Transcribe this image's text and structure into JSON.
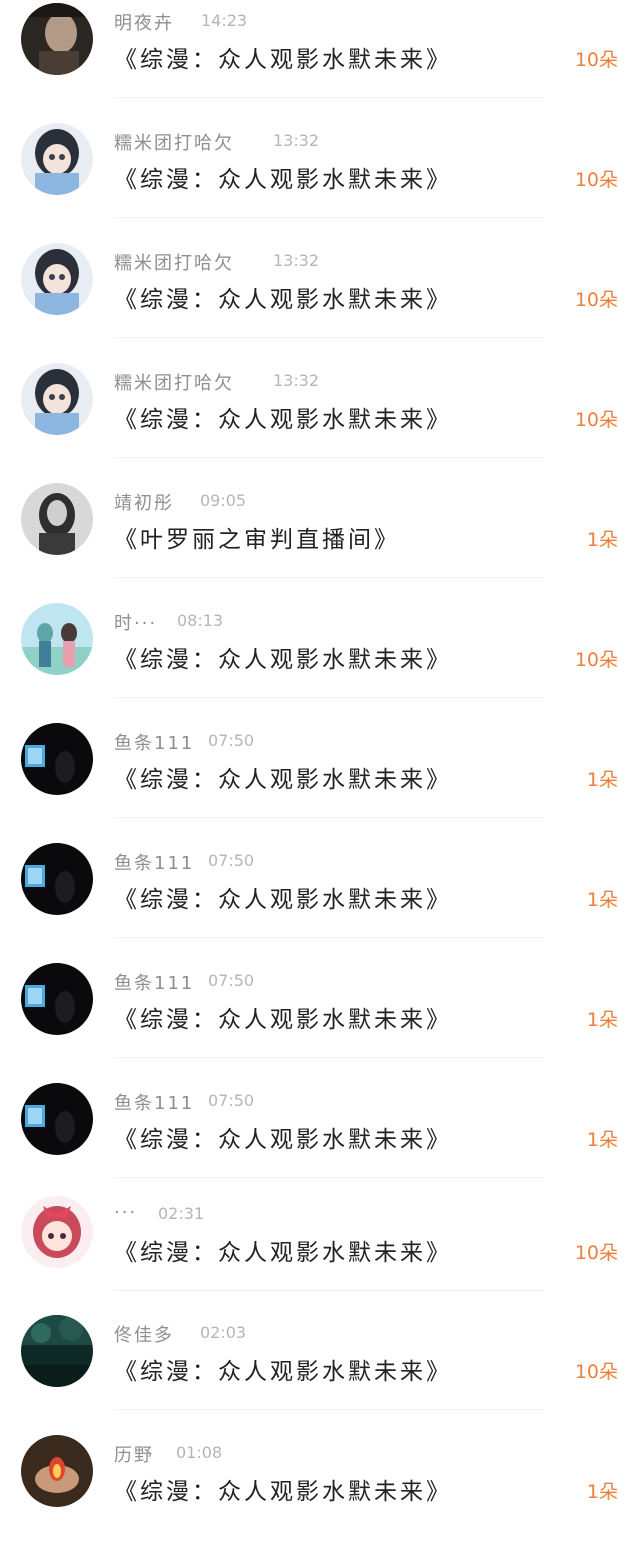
{
  "messages": [
    {
      "name": "明夜卉",
      "time": "14:23",
      "title": "《综漫：众人观影水默未来》",
      "count": "10朵",
      "avatar": "dark-portrait-icon"
    },
    {
      "name": "糯米团打哈欠",
      "time": "13:32",
      "title": "《综漫：众人观影水默未来》",
      "count": "10朵",
      "avatar": "anime-girl-icon"
    },
    {
      "name": "糯米团打哈欠",
      "time": "13:32",
      "title": "《综漫：众人观影水默未来》",
      "count": "10朵",
      "avatar": "anime-girl-icon"
    },
    {
      "name": "糯米团打哈欠",
      "time": "13:32",
      "title": "《综漫：众人观影水默未来》",
      "count": "10朵",
      "avatar": "anime-girl-icon"
    },
    {
      "name": "靖初彤",
      "time": "09:05",
      "title": "《叶罗丽之审判直播间》",
      "count": "1朵",
      "avatar": "grayscale-portrait-icon"
    },
    {
      "name": "时···",
      "time": "08:13",
      "title": "《综漫：众人观影水默未来》",
      "count": "10朵",
      "avatar": "anime-couple-icon"
    },
    {
      "name": "鱼条111",
      "time": "07:50",
      "title": "《综漫：众人观影水默未来》",
      "count": "1朵",
      "avatar": "dark-screen-icon"
    },
    {
      "name": "鱼条111",
      "time": "07:50",
      "title": "《综漫：众人观影水默未来》",
      "count": "1朵",
      "avatar": "dark-screen-icon"
    },
    {
      "name": "鱼条111",
      "time": "07:50",
      "title": "《综漫：众人观影水默未来》",
      "count": "1朵",
      "avatar": "dark-screen-icon"
    },
    {
      "name": "鱼条111",
      "time": "07:50",
      "title": "《综漫：众人观影水默未来》",
      "count": "1朵",
      "avatar": "dark-screen-icon"
    },
    {
      "name": "···",
      "time": "02:31",
      "title": "《综漫：众人观影水默未来》",
      "count": "10朵",
      "avatar": "cartoon-girl-bow-icon"
    },
    {
      "name": "佟佳多",
      "time": "02:03",
      "title": "《综漫：众人观影水默未来》",
      "count": "10朵",
      "avatar": "forest-icon"
    },
    {
      "name": "历野",
      "time": "01:08",
      "title": "《综漫：众人观影水默未来》",
      "count": "1朵",
      "avatar": "hand-flame-icon"
    }
  ],
  "colors": {
    "count": "#ef7f3a",
    "name": "#8f8f8f",
    "time": "#b6b6b6",
    "title": "#222222",
    "divider": "#f2f2f2"
  }
}
